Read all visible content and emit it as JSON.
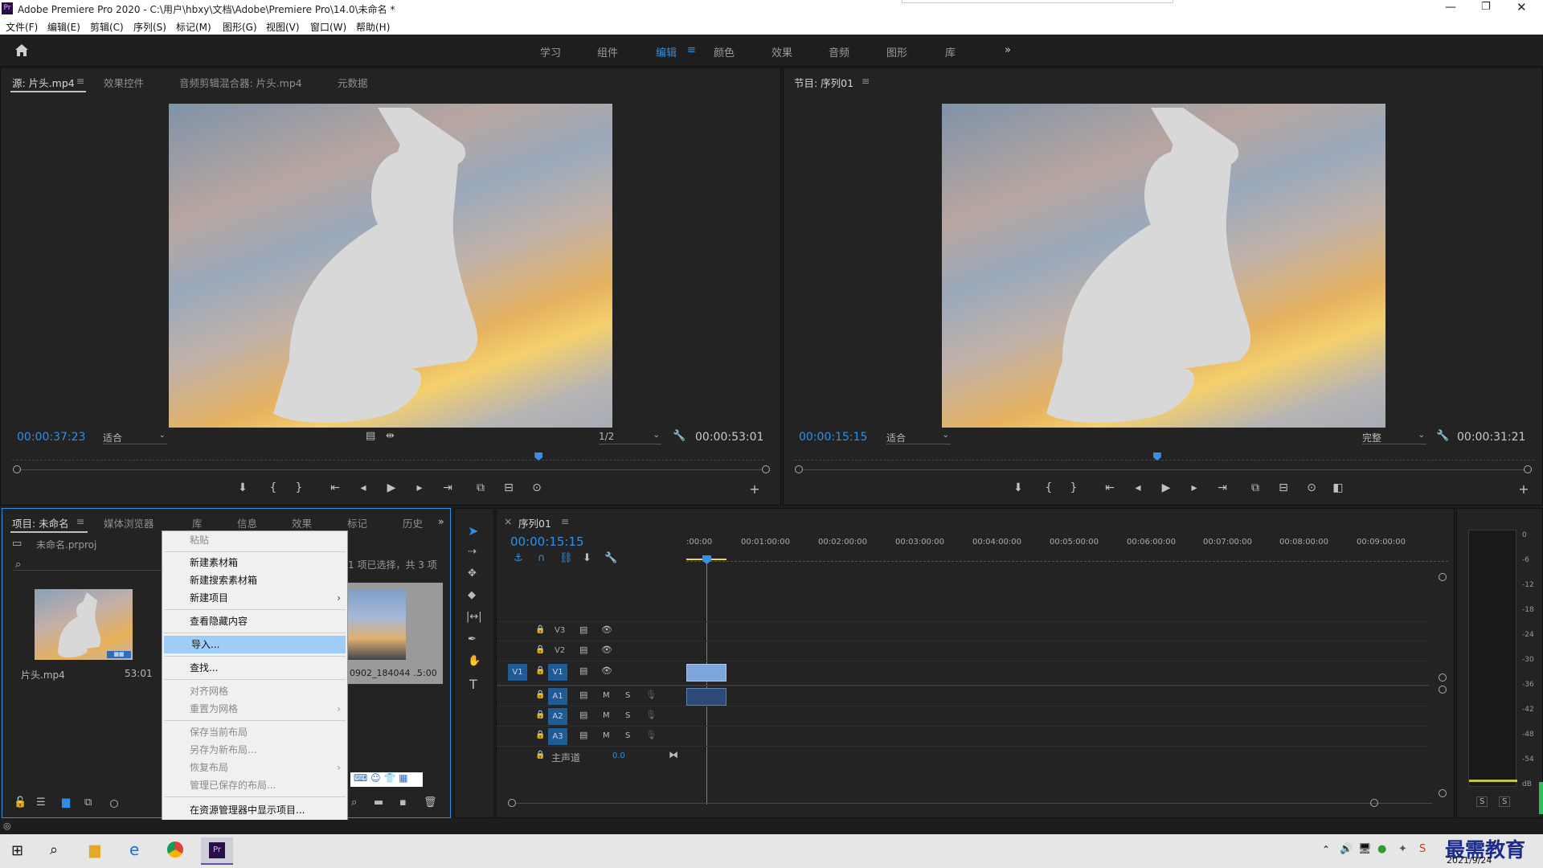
{
  "app": {
    "title": "Adobe Premiere Pro 2020 - C:\\用户\\hbxy\\文档\\Adobe\\Premiere Pro\\14.0\\未命名 *",
    "logo": "Pr"
  },
  "menu": [
    "文件(F)",
    "编辑(E)",
    "剪辑(C)",
    "序列(S)",
    "标记(M)",
    "图形(G)",
    "视图(V)",
    "窗口(W)",
    "帮助(H)"
  ],
  "workspaces": [
    "学习",
    "组件",
    "编辑",
    "颜色",
    "效果",
    "音频",
    "图形",
    "库",
    "»"
  ],
  "workspace_active_menu": "≡",
  "source": {
    "tabs": [
      "源: 片头.mp4",
      "效果控件",
      "音频剪辑混合器: 片头.mp4",
      "元数据"
    ],
    "menu_icon": "≡",
    "timecode": "00:00:37:23",
    "fit": "适合",
    "resolution": "1/2",
    "duration": "00:00:53:01",
    "playhead": 0.7
  },
  "program": {
    "tab": "节目: 序列01",
    "menu_icon": "≡",
    "timecode": "00:00:15:15",
    "fit": "适合",
    "quality": "完整",
    "duration": "00:00:31:21",
    "playhead": 0.49
  },
  "project": {
    "tabs": [
      "项目: 未命名",
      "媒体浏览器",
      "库",
      "信息",
      "效果",
      "标记",
      "历史"
    ],
    "menu_icon": "≡",
    "more": "»",
    "file": "未命名.prproj",
    "selection": "1 项已选择，共 3 项",
    "items": [
      {
        "name": "片头.mp4",
        "duration": "53:01"
      },
      {
        "name": "0902_184044 ...",
        "duration": "5:00"
      }
    ]
  },
  "context_menu": {
    "items": [
      {
        "label": "粘贴",
        "disabled": true
      },
      {
        "label": "新建素材箱"
      },
      {
        "label": "新建搜索素材箱"
      },
      {
        "label": "新建项目",
        "submenu": true
      },
      {
        "label": "查看隐藏内容"
      },
      {
        "label": "导入...",
        "highlight": true
      },
      {
        "label": "查找..."
      },
      {
        "label": "对齐网格",
        "disabled": true
      },
      {
        "label": "重置为网格",
        "disabled": true,
        "submenu": true
      },
      {
        "label": "保存当前布局",
        "disabled": true
      },
      {
        "label": "另存为新布局...",
        "disabled": true
      },
      {
        "label": "恢复布局",
        "disabled": true,
        "submenu": true
      },
      {
        "label": "管理已保存的布局...",
        "disabled": true
      },
      {
        "label": "在资源管理器中显示项目..."
      }
    ],
    "submenu_arrow": "›"
  },
  "timeline": {
    "tab": "序列01",
    "close": "×",
    "menu_icon": "≡",
    "timecode": "00:00:15:15",
    "ruler": [
      ":00:00",
      "00:01:00:00",
      "00:02:00:00",
      "00:03:00:00",
      "00:04:00:00",
      "00:05:00:00",
      "00:06:00:00",
      "00:07:00:00",
      "00:08:00:00",
      "00:09:00:00"
    ],
    "video_tracks": [
      "V3",
      "V2",
      "V1"
    ],
    "audio_tracks": [
      "A1",
      "A2",
      "A3"
    ],
    "source_patch": "V1",
    "master": "主声道",
    "master_value": "0.0",
    "mute": "M",
    "solo": "S"
  },
  "meter": {
    "labels": [
      "0",
      "-6",
      "-12",
      "-18",
      "-24",
      "-30",
      "-36",
      "-42",
      "-48",
      "-54",
      "dB"
    ],
    "solo": [
      "S",
      "S"
    ]
  },
  "taskbar": {
    "date": "2021/9/24",
    "watermark": "最需教育"
  }
}
